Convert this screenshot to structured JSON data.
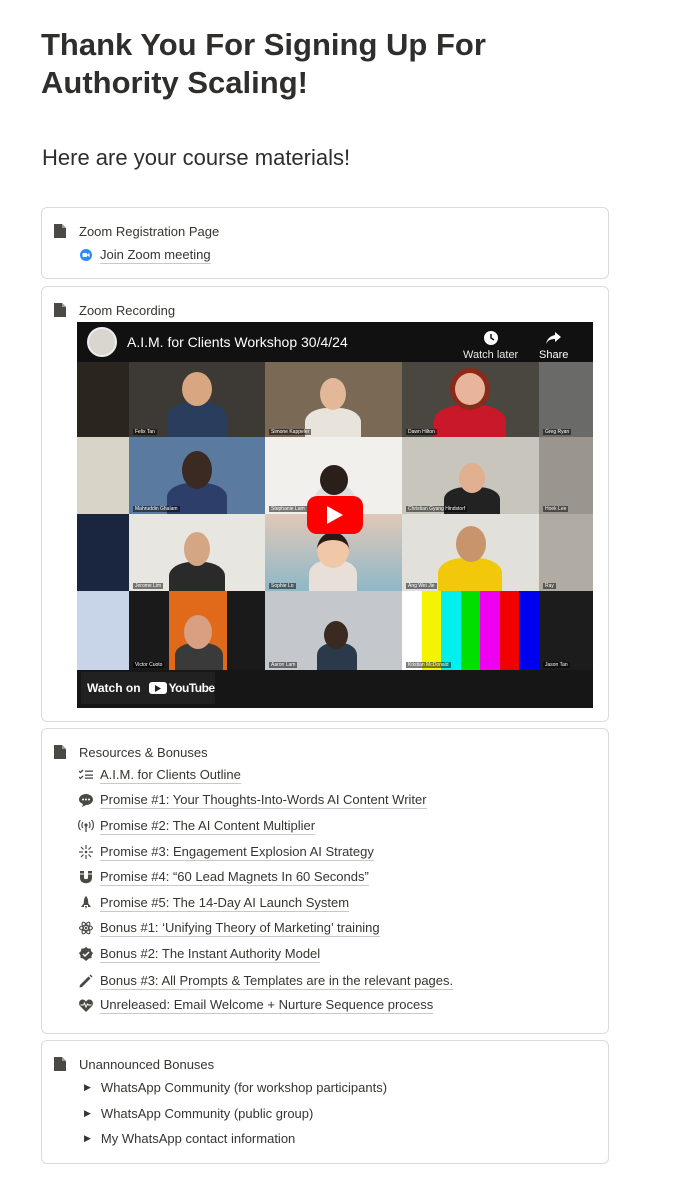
{
  "page": {
    "title": "Thank You For Signing Up For Authority Scaling!",
    "subtitle": "Here are your course materials!"
  },
  "zoom_registration": {
    "title": "Zoom Registration Page",
    "link_label": "Join Zoom meeting"
  },
  "zoom_recording": {
    "title": "Zoom Recording",
    "video": {
      "title": "A.I.M. for Clients Workshop 30/4/24",
      "watch_later": "Watch later",
      "share": "Share",
      "watch_on": "Watch on",
      "youtube": "YouTube",
      "participants": [
        "Felix Tan",
        "Simone Kappeler",
        "Dawn Hilton",
        "Greg Ryan",
        "Mahruddin Ghalam",
        "Stephanie Lam",
        "Christian Gyang Hindstorf",
        "Hoek Lee",
        "Jerome Lim",
        "Sophie Lo",
        "Ang Wei Jie",
        "Ray",
        "Victor Cuoto",
        "Aaron Lam",
        "Kristian McDonald",
        "Jason Tan"
      ]
    }
  },
  "resources": {
    "title": "Resources & Bonuses",
    "items": [
      {
        "icon": "checklist-icon",
        "label": "A.I.M. for Clients Outline"
      },
      {
        "icon": "chat-bubble-icon",
        "label": "Promise #1: Your Thoughts-Into-Words AI Content Writer"
      },
      {
        "icon": "broadcast-icon",
        "label": "Promise #2: The AI Content Multiplier"
      },
      {
        "icon": "sparkle-burst-icon",
        "label": "Promise #3: Engagement Explosion AI Strategy"
      },
      {
        "icon": "magnet-icon",
        "label": "Promise #4: “60 Lead Magnets In 60 Seconds”"
      },
      {
        "icon": "rocket-icon",
        "label": "Promise #5: The 14-Day AI Launch System"
      },
      {
        "icon": "atom-icon",
        "label": "Bonus #1: ‘Unifying Theory of Marketing’ training"
      },
      {
        "icon": "verified-badge-icon",
        "label": "Bonus #2: The Instant Authority Model"
      },
      {
        "icon": "pencil-icon",
        "label": "Bonus #3: All Prompts & Templates are in the relevant pages."
      },
      {
        "icon": "heart-pulse-icon",
        "label": "Unreleased: Email Welcome + Nurture Sequence process"
      }
    ]
  },
  "unannounced": {
    "title": "Unannounced Bonuses",
    "items": [
      {
        "label": "WhatsApp Community (for workshop participants)"
      },
      {
        "label": "WhatsApp Community (public group)"
      },
      {
        "label": "My WhatsApp contact information"
      }
    ]
  },
  "colors": {
    "text": "#37352f",
    "border": "#dcdbd7",
    "zoom_blue": "#2d8cff",
    "youtube_red": "#ff0000"
  }
}
